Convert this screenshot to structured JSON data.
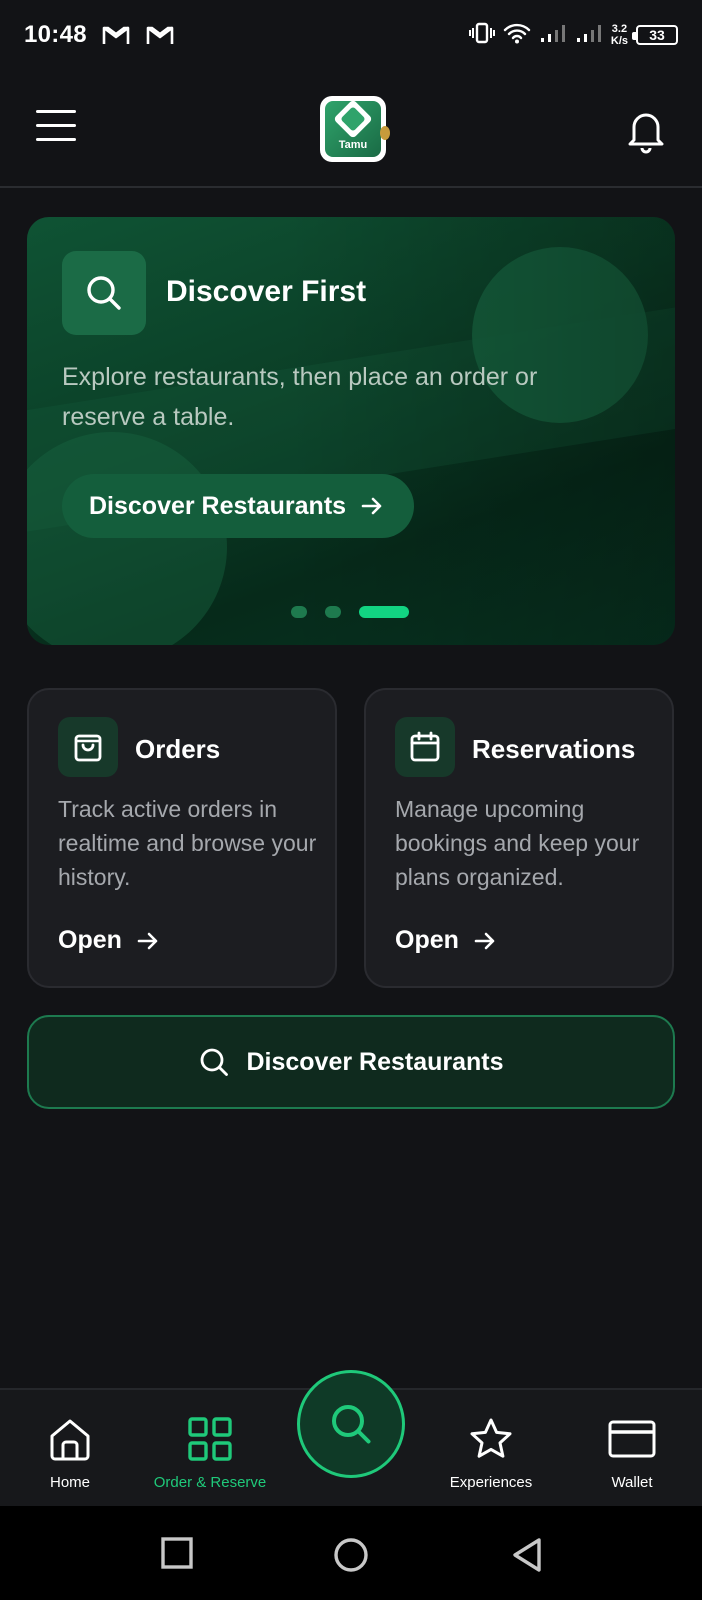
{
  "status_bar": {
    "time": "10:48",
    "net_speed_value": "3.2",
    "net_speed_unit": "K/s",
    "battery": "33"
  },
  "header": {
    "logo_text": "Tamu"
  },
  "hero": {
    "title": "Discover First",
    "description": "Explore restaurants, then place an order or reserve a table.",
    "button_label": "Discover Restaurants",
    "carousel_pages": 3,
    "carousel_active_index": 2
  },
  "cards": {
    "orders": {
      "title": "Orders",
      "description": "Track active orders in realtime and browse your history.",
      "action": "Open"
    },
    "reservations": {
      "title": "Reservations",
      "description": "Manage upcoming bookings and keep your plans organized.",
      "action": "Open"
    }
  },
  "discover_button": {
    "label": "Discover Restaurants"
  },
  "bottom_nav": {
    "items": [
      {
        "label": "Home",
        "icon": "home-icon"
      },
      {
        "label": "Order & Reserve",
        "icon": "grid-icon"
      },
      {
        "label": "",
        "icon": "search-icon"
      },
      {
        "label": "Experiences",
        "icon": "star-icon"
      },
      {
        "label": "Wallet",
        "icon": "wallet-icon"
      }
    ],
    "active": "Order & Reserve"
  },
  "colors": {
    "accent": "#1fc97a",
    "background": "#121316",
    "card": "#1c1d21",
    "hero": "#0b3f27"
  }
}
